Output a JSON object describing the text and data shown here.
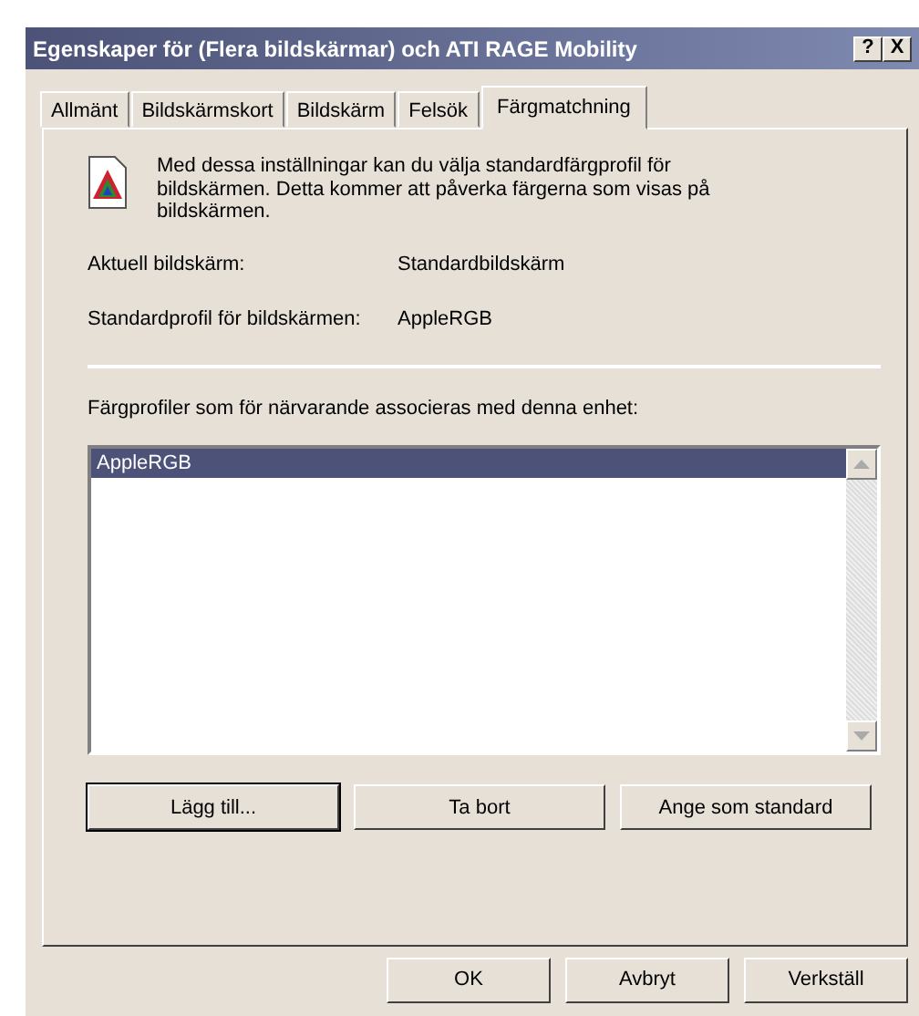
{
  "window": {
    "title": "Egenskaper för (Flera bildskärmar) och ATI RAGE Mobility",
    "title_buttons": [
      "?",
      "X"
    ]
  },
  "tabs": [
    {
      "label": "Allmänt",
      "selected": false
    },
    {
      "label": "Bildskärmskort",
      "selected": false
    },
    {
      "label": "Bildskärm",
      "selected": false
    },
    {
      "label": "Felsök",
      "selected": false
    },
    {
      "label": "Färgmatchning",
      "selected": true
    }
  ],
  "description": "Med dessa inställningar kan du välja standardfärgprofil för bildskärmen. Detta kommer att påverka färgerna som visas på bildskärmen.",
  "fields": [
    {
      "label": "Aktuell bildskärm:",
      "value": "Standardbildskärm"
    },
    {
      "label": "Standardprofil för bildskärmen:",
      "value": "AppleRGB"
    }
  ],
  "profiles": {
    "label": "Färgprofiler som för närvarande associeras med denna enhet:",
    "items": [
      {
        "label": "AppleRGB",
        "selected": true
      }
    ]
  },
  "profile_buttons": [
    {
      "label": "Lägg till...",
      "default": true
    },
    {
      "label": "Ta bort",
      "default": false
    },
    {
      "label": "Ange som standard",
      "default": false
    }
  ],
  "dialog_buttons": [
    "OK",
    "Avbryt",
    "Verkställ"
  ]
}
